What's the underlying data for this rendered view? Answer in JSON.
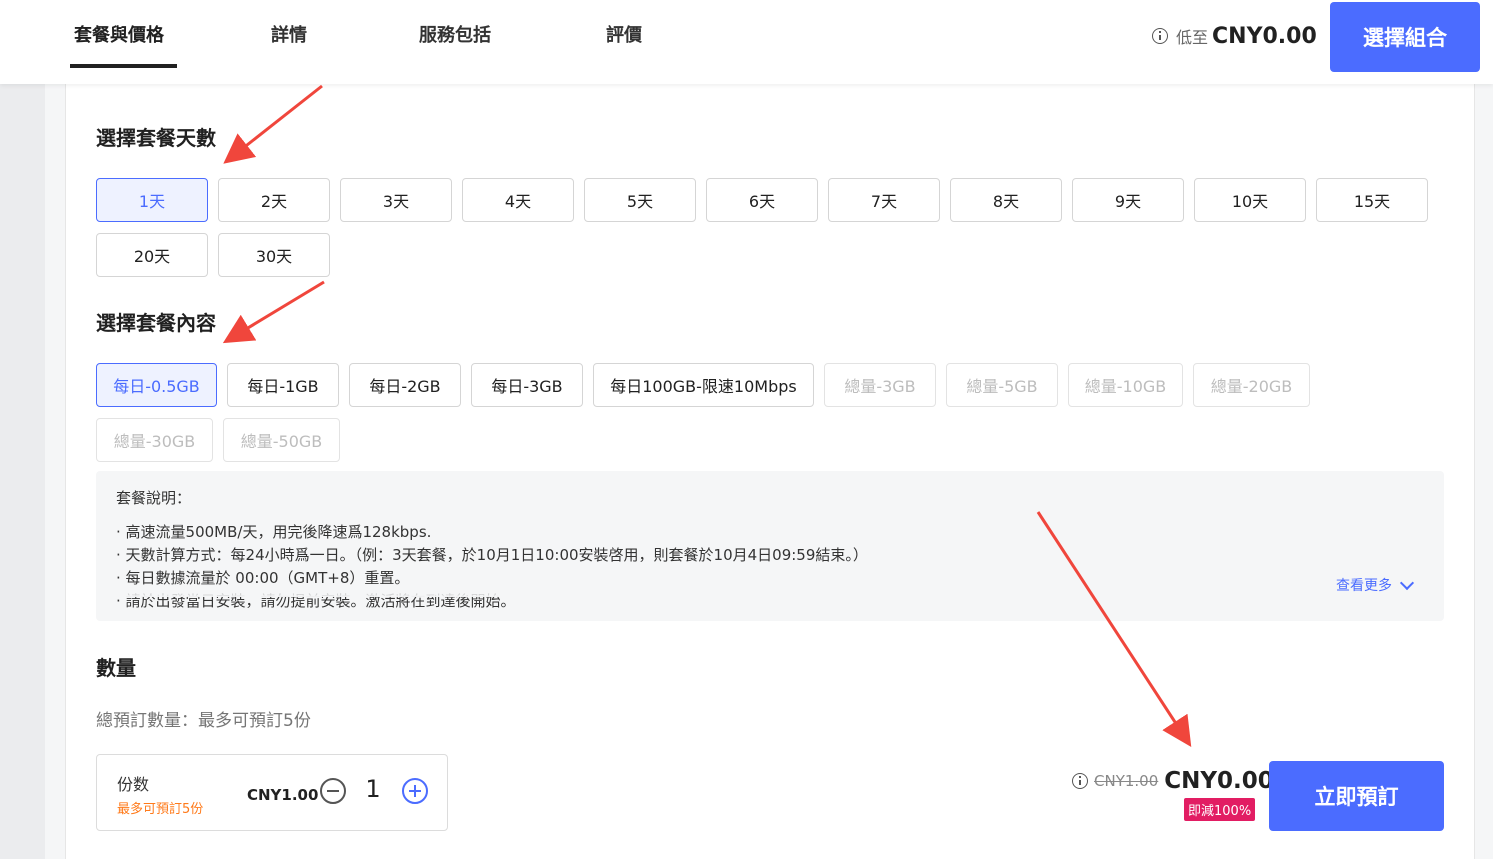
{
  "header": {
    "tabs": [
      {
        "label": "套餐與價格",
        "active": true
      },
      {
        "label": "詳情",
        "active": false
      },
      {
        "label": "服務包括",
        "active": false
      },
      {
        "label": "評價",
        "active": false
      }
    ],
    "price_prefix": "低至",
    "price": "CNY0.00",
    "combo_button": "選擇組合"
  },
  "days": {
    "title": "選擇套餐天數",
    "options": [
      "1天",
      "2天",
      "3天",
      "4天",
      "5天",
      "6天",
      "7天",
      "8天",
      "9天",
      "10天",
      "15天",
      "20天",
      "30天"
    ],
    "selected": "1天"
  },
  "content": {
    "title": "選擇套餐內容",
    "options": [
      {
        "label": "每日-0.5GB",
        "state": "selected"
      },
      {
        "label": "每日-1GB",
        "state": "normal"
      },
      {
        "label": "每日-2GB",
        "state": "normal"
      },
      {
        "label": "每日-3GB",
        "state": "normal"
      },
      {
        "label": "每日100GB-限速10Mbps",
        "state": "normal"
      },
      {
        "label": "總量-3GB",
        "state": "disabled"
      },
      {
        "label": "總量-5GB",
        "state": "disabled"
      },
      {
        "label": "總量-10GB",
        "state": "disabled"
      },
      {
        "label": "總量-20GB",
        "state": "disabled"
      },
      {
        "label": "總量-30GB",
        "state": "disabled"
      },
      {
        "label": "總量-50GB",
        "state": "disabled"
      }
    ]
  },
  "description": {
    "title": "套餐說明：",
    "lines": [
      "· 高速流量500MB/天，用完後降速爲128kbps.",
      "· 天數計算方式：每24小時爲一日。（例：3天套餐，於10月1日10:00安裝啓用，則套餐於10月4日09:59結束。）",
      "· 每日數據流量於 00:00（GMT+8）重置。",
      "· 請於出發當日安裝，請勿提前安裝。激活將在到達後開始。"
    ],
    "see_more": "查看更多"
  },
  "quantity": {
    "title": "數量",
    "subtitle": "總預訂數量：最多可預訂5份",
    "unit_label": "份数",
    "max_note": "最多可預訂5份",
    "unit_price": "CNY1.00",
    "value": "1"
  },
  "summary": {
    "old_price": "CNY1.00",
    "new_price": "CNY0.00",
    "discount": "即減100%",
    "book_button": "立即預訂"
  },
  "colors": {
    "accent": "#4b6cff",
    "discount": "#e21d63",
    "warning": "#ff7a1a",
    "annotation_arrow": "#f0463c"
  }
}
